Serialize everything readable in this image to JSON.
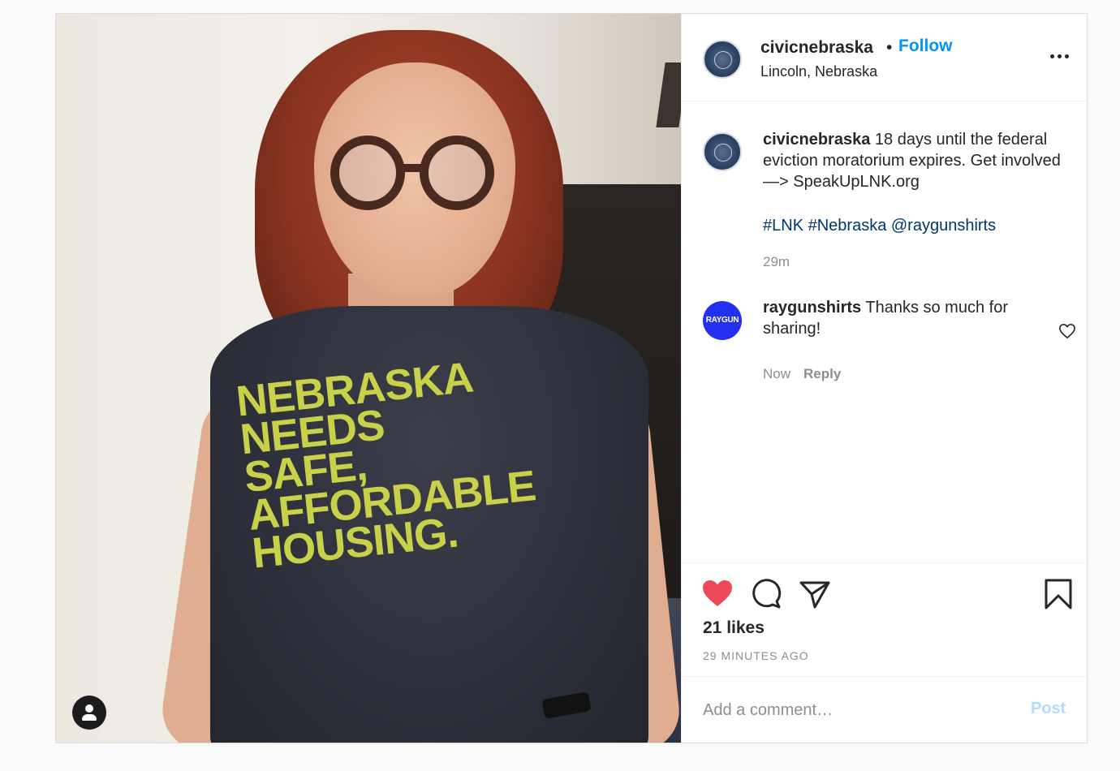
{
  "post": {
    "author": "civicnebraska",
    "follow_label": "Follow",
    "separator": "•",
    "location": "Lincoln, Nebraska",
    "shirt_text": "NEBRASKA\nNEEDS\nSAFE,\nAFFORDABLE\nHOUSING."
  },
  "caption": {
    "username": "civicnebraska",
    "text": "18 days until the federal eviction moratorium expires. Get involved —> SpeakUpLNK.org",
    "tags": [
      "#LNK",
      "#Nebraska",
      "@raygunshirts"
    ],
    "time": "29m"
  },
  "reply": {
    "avatar_text": "RAYGUN",
    "username": "raygunshirts",
    "text": "Thanks so much for sharing!",
    "time": "Now",
    "reply_label": "Reply"
  },
  "actions": {
    "likes": "21 likes",
    "timestamp": "29 MINUTES AGO",
    "liked": true,
    "like_color": "#ed4956"
  },
  "add_comment": {
    "placeholder": "Add a comment…",
    "post_label": "Post"
  },
  "icons": [
    "more-icon",
    "heart-icon",
    "comment-icon",
    "share-icon",
    "bookmark-icon",
    "user-tag-icon",
    "small-heart-icon"
  ]
}
